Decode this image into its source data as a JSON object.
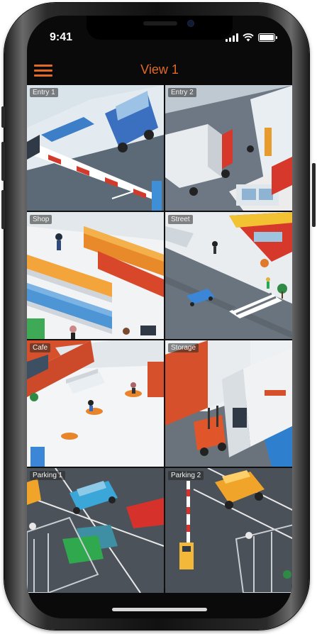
{
  "status_bar": {
    "time": "9:41",
    "icons": [
      "signal-icon",
      "wifi-icon",
      "battery-icon"
    ]
  },
  "header": {
    "title": "View 1",
    "menu_icon": "hamburger-menu-icon",
    "accent_color": "#e06a26"
  },
  "cameras": [
    {
      "label": "Entry 1"
    },
    {
      "label": "Entry 2"
    },
    {
      "label": "Shop"
    },
    {
      "label": "Street"
    },
    {
      "label": "Cafe"
    },
    {
      "label": "Storage"
    },
    {
      "label": "Parking 1"
    },
    {
      "label": "Parking 2"
    }
  ]
}
